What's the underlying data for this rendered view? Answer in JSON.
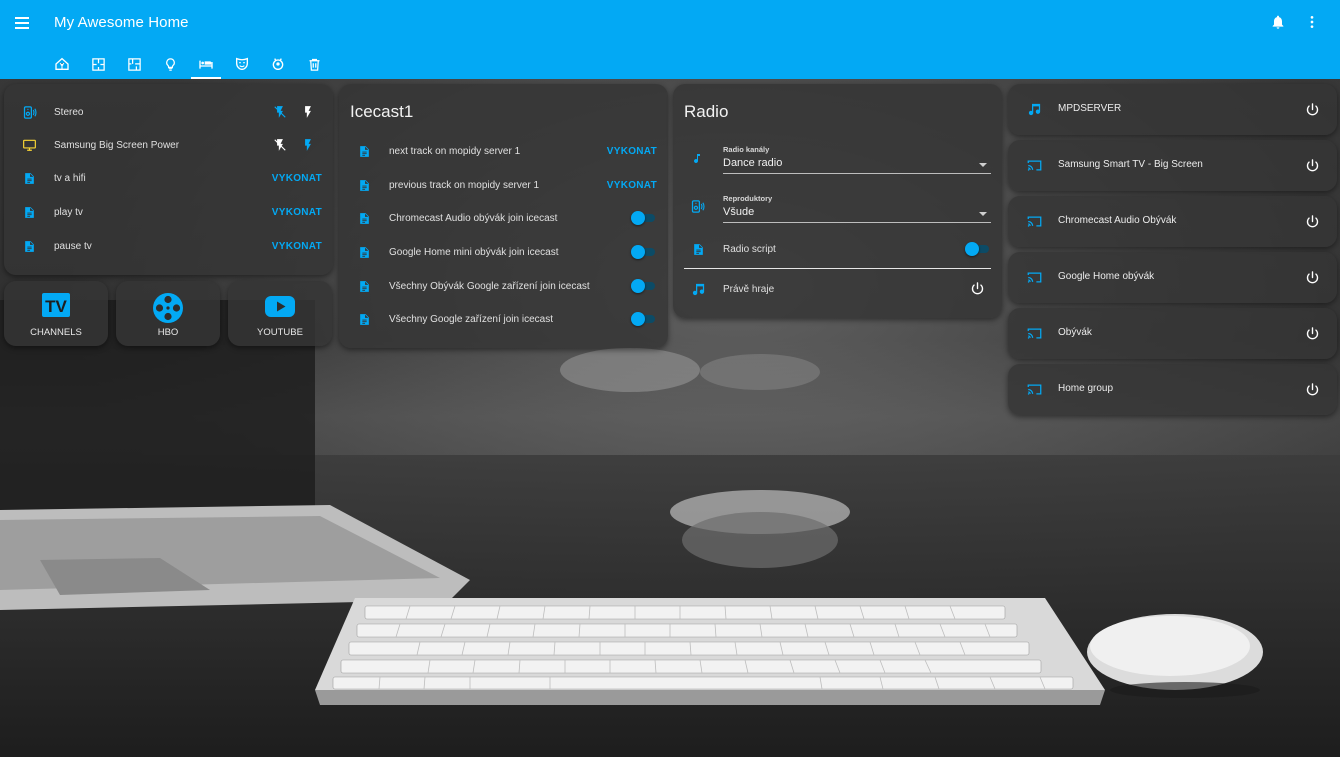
{
  "header": {
    "title": "My Awesome Home",
    "tabs": [
      {
        "icon": "home-assistant-icon"
      },
      {
        "icon": "floor-plan-icon"
      },
      {
        "icon": "floor-plan-alt-icon"
      },
      {
        "icon": "lightbulb-icon"
      },
      {
        "icon": "bed-icon",
        "active": true
      },
      {
        "icon": "drama-masks-icon"
      },
      {
        "icon": "robot-vacuum-icon"
      },
      {
        "icon": "trash-can-icon"
      }
    ]
  },
  "colors": {
    "accent": "#03a9f4",
    "tv_icon": "#fdd835",
    "card_bg": "#343434"
  },
  "devices_card": {
    "rows": [
      {
        "label": "Stereo",
        "icon": "speaker-icon",
        "icon_color": "#03a9f4",
        "control": "flash-buttons"
      },
      {
        "label": "Samsung Big Screen Power",
        "icon": "television-icon",
        "icon_color": "#fdd835",
        "control": "flash-buttons"
      },
      {
        "label": "tv a hifi",
        "icon": "file-document-icon",
        "action": "VYKONAT"
      },
      {
        "label": "play tv",
        "icon": "file-document-icon",
        "action": "VYKONAT"
      },
      {
        "label": "pause tv",
        "icon": "file-document-icon",
        "action": "VYKONAT"
      }
    ]
  },
  "tiles": [
    {
      "label": "CHANNELS",
      "icon": "tv-box-icon"
    },
    {
      "label": "HBO",
      "icon": "film-reel-icon"
    },
    {
      "label": "YOUTUBE",
      "icon": "youtube-icon"
    }
  ],
  "icecast_card": {
    "title": "Icecast1",
    "rows": [
      {
        "label": "next track on mopidy server 1",
        "action": "VYKONAT"
      },
      {
        "label": "previous track on mopidy server 1",
        "action": "VYKONAT"
      },
      {
        "label": "Chromecast Audio obývák join icecast",
        "toggle": true
      },
      {
        "label": "Google Home mini obývák join icecast",
        "toggle": true
      },
      {
        "label": "Všechny Obývák Google zařízení join icecast",
        "toggle": true
      },
      {
        "label": "Všechny Google zařízení join icecast",
        "toggle": true
      }
    ]
  },
  "radio_card": {
    "title": "Radio",
    "channel_label": "Radio kanály",
    "channel_value": "Dance radio",
    "speakers_label": "Reproduktory",
    "speakers_value": "Všude",
    "script_label": "Radio script",
    "script_on": true,
    "now_playing_label": "Právě hraje"
  },
  "media_players": [
    {
      "label": "MPDSERVER",
      "icon": "music-note-icon"
    },
    {
      "label": "Samsung Smart TV - Big Screen",
      "icon": "cast-icon"
    },
    {
      "label": "Chromecast Audio Obývák",
      "icon": "cast-icon"
    },
    {
      "label": "Google Home obývák",
      "icon": "cast-icon"
    },
    {
      "label": "Obývák",
      "icon": "cast-icon"
    },
    {
      "label": "Home group",
      "icon": "cast-icon"
    }
  ]
}
